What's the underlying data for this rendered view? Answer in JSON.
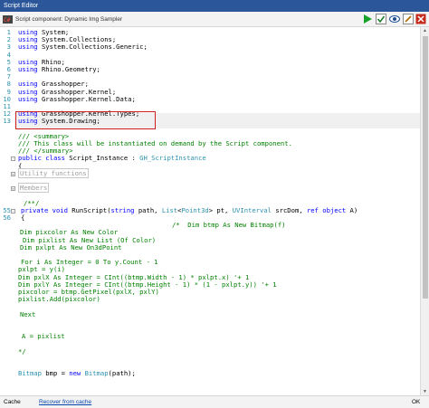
{
  "window": {
    "title": "Script Editor"
  },
  "toolbar": {
    "component_title": "Script component: Dynamic Img Sampler"
  },
  "colors": {
    "keyword": "#0000ff",
    "type": "#2b91af",
    "comment": "#008000",
    "highlight_box": "#d11f1f",
    "titlebar": "#2b579a"
  },
  "icons": [
    "script-component-icon",
    "run-icon",
    "checkmark-icon",
    "eye-icon",
    "edit-icon",
    "close-icon"
  ],
  "code_lines": [
    {
      "ln": "1",
      "text": "using System;"
    },
    {
      "ln": "2",
      "text": "using System.Collections;"
    },
    {
      "ln": "3",
      "text": "using System.Collections.Generic;"
    },
    {
      "ln": "4",
      "text": ""
    },
    {
      "ln": "5",
      "text": "using Rhino;"
    },
    {
      "ln": "6",
      "text": "using Rhino.Geometry;"
    },
    {
      "ln": "7",
      "text": ""
    },
    {
      "ln": "8",
      "text": "using Grasshopper;"
    },
    {
      "ln": "9",
      "text": "using Grasshopper.Kernel;"
    },
    {
      "ln": "10",
      "text": "using Grasshopper.Kernel.Data;"
    },
    {
      "ln": "11",
      "text": ""
    },
    {
      "ln": "12",
      "text": "using Grasshopper.Kernel.Types;"
    },
    {
      "ln": "13",
      "text": "using System.Drawing;"
    },
    {
      "ln": "",
      "text": ""
    },
    {
      "ln": "",
      "text": "/// <summary>"
    },
    {
      "ln": "",
      "text": "/// This class will be instantiated on demand by the Script component."
    },
    {
      "ln": "",
      "text": "/// </summary>"
    },
    {
      "ln": "",
      "text": "public class Script_Instance : GH_ScriptInstance"
    },
    {
      "ln": "",
      "text": "{"
    },
    {
      "ln": "",
      "text": "Utility functions"
    },
    {
      "ln": "",
      "text": ""
    },
    {
      "ln": "",
      "text": "Members"
    },
    {
      "ln": "",
      "text": ""
    },
    {
      "ln": "",
      "text": "/**/"
    },
    {
      "ln": "55",
      "text": "private void RunScript(string path, List<Point3d> pt, UVInterval srcDom, ref object A)"
    },
    {
      "ln": "56",
      "text": "{"
    },
    {
      "ln": "",
      "text": "/*  Dim btmp As New Bitmap(f)"
    },
    {
      "ln": "",
      "text": "Dim pixcolor As New Color"
    },
    {
      "ln": "",
      "text": "Dim pixlist As New List (Of Color)"
    },
    {
      "ln": "",
      "text": "Dim pxlpt As New On3dPoint"
    },
    {
      "ln": "",
      "text": ""
    },
    {
      "ln": "",
      "text": "For i As Integer = 0 To y.Count - 1"
    },
    {
      "ln": "",
      "text": "pxlpt = y(i)"
    },
    {
      "ln": "",
      "text": "Dim pxlX As Integer = CInt((btmp.Width - 1) * pxlpt.x) '+ 1"
    },
    {
      "ln": "",
      "text": "Dim pxlY As Integer = CInt((btmp.Height - 1) * (1 - pxlpt.y)) '+ 1"
    },
    {
      "ln": "",
      "text": "pixcolor = btmp.GetPixel(pxlX, pxlY)"
    },
    {
      "ln": "",
      "text": "pixlist.Add(pixcolor)"
    },
    {
      "ln": "",
      "text": ""
    },
    {
      "ln": "",
      "text": "Next"
    },
    {
      "ln": "",
      "text": ""
    },
    {
      "ln": "",
      "text": ""
    },
    {
      "ln": "",
      "text": "A = pixlist"
    },
    {
      "ln": "",
      "text": ""
    },
    {
      "ln": "",
      "text": "*/"
    },
    {
      "ln": "",
      "text": ""
    },
    {
      "ln": "",
      "text": ""
    },
    {
      "ln": "",
      "text": "Bitmap bmp = new Bitmap(path);"
    },
    {
      "ln": "",
      "text": ""
    }
  ],
  "statusbar": {
    "cache_label": "Cache",
    "recover_label": "Recover from cache",
    "ok_label": "OK"
  }
}
